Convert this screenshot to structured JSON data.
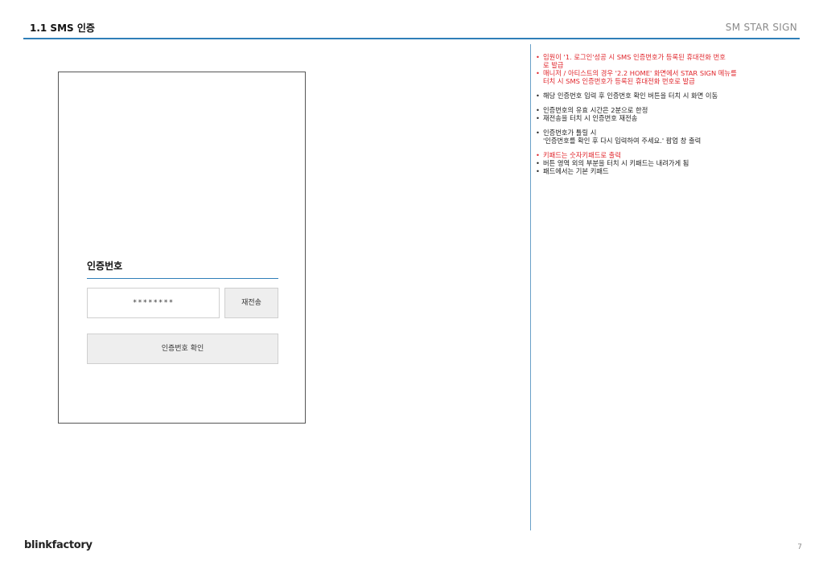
{
  "header": {
    "title": "1.1 SMS 인증",
    "brand": "SM STAR SIGN"
  },
  "phone": {
    "label": "인증번호",
    "code_value": "********",
    "resend_label": "재전송",
    "confirm_label": "인증번호 확인"
  },
  "notes": [
    {
      "lines": [
        {
          "text": "임원이 '1. 로그인'성공 시 SMS 인증번호가 등록된 휴대전화 번호",
          "color": "red",
          "bullet": true
        },
        {
          "text": "로 발급",
          "color": "red",
          "bullet": false
        },
        {
          "text": "매니저 / 아티스트의 경우 '2.2 HOME' 화면에서 STAR SIGN 메뉴를",
          "color": "red",
          "bullet": true
        },
        {
          "text": "터치 시 SMS 인증번호가 등록된 휴대전화 번호로 발급",
          "color": "red",
          "bullet": false
        }
      ]
    },
    {
      "lines": [
        {
          "text": "해당 인증번호 입력 후 인증번호 확인 버튼을 터치 시 화면 이동",
          "color": "dark",
          "bullet": true
        }
      ]
    },
    {
      "lines": [
        {
          "text": "인증번호의 유효 시간은 2분으로 한정",
          "color": "dark",
          "bullet": true
        },
        {
          "text": "재전송을 터치 시 인증번호 재전송",
          "color": "dark",
          "bullet": true
        }
      ]
    },
    {
      "lines": [
        {
          "text": "인증번호가 틀릴 시",
          "color": "dark",
          "bullet": true
        },
        {
          "text": "'인증번호를 확인 후 다시 입력하여 주세요.' 팝업 창 출력",
          "color": "dark",
          "bullet": false
        }
      ]
    },
    {
      "lines": [
        {
          "text": "키패드는 숫자키패드로 출력",
          "color": "red",
          "bullet": true
        },
        {
          "text": "버튼 영역 외의 부분을 터치 시 키패드는 내려가게 됨",
          "color": "dark",
          "bullet": true
        },
        {
          "text": "패드에서는 기본 키패드",
          "color": "dark",
          "bullet": true
        }
      ]
    }
  ],
  "footer": {
    "logo": "blinkfactory",
    "page": "7"
  },
  "colors": {
    "accent": "#2f7fb8",
    "note_red": "#e0252b"
  }
}
